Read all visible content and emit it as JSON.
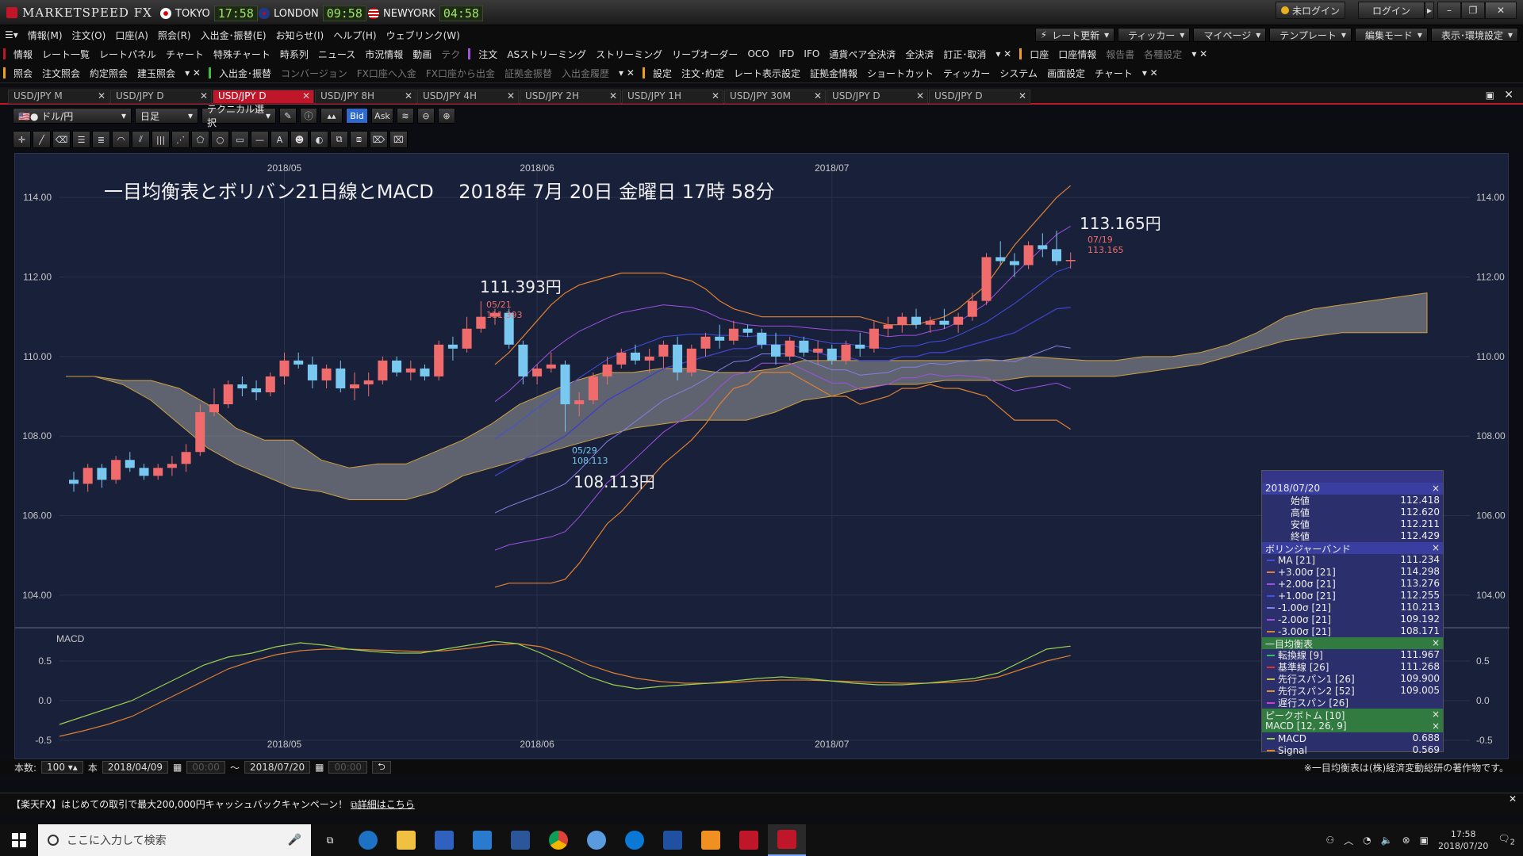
{
  "app": {
    "title": "MARKETSPEED FX",
    "tokyo_label": "TOKYO",
    "tokyo_time": "17:58",
    "london_label": "LONDON",
    "london_time": "09:58",
    "newyork_label": "NEWYORK",
    "newyork_time": "04:58",
    "login_status": "未ログイン",
    "login_button": "ログイン"
  },
  "menu_main": [
    "情報(M)",
    "注文(O)",
    "口座(A)",
    "照会(R)",
    "入出金･振替(E)",
    "お知らせ(I)",
    "ヘルプ(H)",
    "ウェブリンク(W)"
  ],
  "menu_right": [
    "レート更新",
    "ティッカー",
    "マイページ",
    "テンプレート",
    "編集モード",
    "表示･環境設定"
  ],
  "toolbar_row1": {
    "info_label": "情報",
    "info_items": [
      "レート一覧",
      "レートパネル",
      "チャート",
      "特殊チャート",
      "時系列",
      "ニュース",
      "市況情報",
      "動画",
      "テク"
    ],
    "order_label": "注文",
    "order_items": [
      "ASストリーミング",
      "ストリーミング",
      "リーブオーダー",
      "OCO",
      "IFD",
      "IFO",
      "通貨ペア全決済",
      "全決済",
      "訂正･取消"
    ],
    "account_label": "口座",
    "account_items": [
      "口座情報",
      "報告書",
      "各種設定"
    ]
  },
  "toolbar_row2": {
    "inquiry_label": "照会",
    "inquiry_items": [
      "注文照会",
      "約定照会",
      "建玉照会"
    ],
    "transfer_label": "入出金･振替",
    "transfer_items": [
      "コンバージョン",
      "FX口座へ入金",
      "FX口座から出金",
      "証拠金振替",
      "入出金履歴"
    ],
    "settings_label": "設定",
    "settings_items": [
      "注文･約定",
      "レート表示設定",
      "証拠金情報",
      "ショートカット",
      "ティッカー",
      "システム",
      "画面設定",
      "チャート"
    ]
  },
  "tabs": [
    "USD/JPY M",
    "USD/JPY D",
    "USD/JPY D",
    "USD/JPY 8H",
    "USD/JPY 4H",
    "USD/JPY 2H",
    "USD/JPY 1H",
    "USD/JPY 30M",
    "USD/JPY D",
    "USD/JPY D"
  ],
  "active_tab": 2,
  "chart_toolbar": {
    "pair": "ドル/円",
    "period": "日足",
    "technical": "テクニカル選択",
    "bid": "Bid",
    "ask": "Ask"
  },
  "chart_title": "一目均衡表とボリバン21日線とMACD　 2018年 7月 20日 金曜日 17時 58分",
  "annotations": {
    "high1_label": "111.393円",
    "high1_date": "05/21",
    "high1_val": "111.393",
    "low_label": "108.113円",
    "low_date": "05/29",
    "low_val": "108.113",
    "high2_label": "113.165円",
    "high2_date": "07/19",
    "high2_val": "113.165"
  },
  "chart_data": {
    "type": "candlestick",
    "title": "一目均衡表とボリバン21日線とMACD",
    "x_ticks": [
      "2018/05",
      "2018/06",
      "2018/07"
    ],
    "y_ticks": [
      "104.00",
      "106.00",
      "108.00",
      "110.00",
      "112.00",
      "114.00"
    ],
    "ylim": [
      103.2,
      115.1
    ],
    "macd_label": "MACD",
    "macd_ticks": [
      "0.5",
      "0.0",
      "-0.5"
    ],
    "macd_ylim": [
      -0.75,
      0.9
    ],
    "candles": [
      [
        106.9,
        107.1,
        106.6,
        106.8
      ],
      [
        106.8,
        107.3,
        106.6,
        107.2
      ],
      [
        107.2,
        107.3,
        106.7,
        106.9
      ],
      [
        106.9,
        107.5,
        106.8,
        107.4
      ],
      [
        107.4,
        107.6,
        107.1,
        107.2
      ],
      [
        107.2,
        107.3,
        106.9,
        107.0
      ],
      [
        107.0,
        107.3,
        106.9,
        107.2
      ],
      [
        107.2,
        107.5,
        107.0,
        107.3
      ],
      [
        107.3,
        107.8,
        107.1,
        107.6
      ],
      [
        107.6,
        108.8,
        107.5,
        108.6
      ],
      [
        108.6,
        109.2,
        108.5,
        108.8
      ],
      [
        108.8,
        109.4,
        108.7,
        109.3
      ],
      [
        109.3,
        109.5,
        109.0,
        109.2
      ],
      [
        109.2,
        109.4,
        108.9,
        109.1
      ],
      [
        109.1,
        109.6,
        109.0,
        109.5
      ],
      [
        109.5,
        110.1,
        109.3,
        109.9
      ],
      [
        109.9,
        110.1,
        109.7,
        109.8
      ],
      [
        109.8,
        110.0,
        109.2,
        109.4
      ],
      [
        109.4,
        109.8,
        109.2,
        109.7
      ],
      [
        109.7,
        109.9,
        109.1,
        109.2
      ],
      [
        109.2,
        109.6,
        108.9,
        109.3
      ],
      [
        109.3,
        109.6,
        109.0,
        109.4
      ],
      [
        109.4,
        110.0,
        109.3,
        109.9
      ],
      [
        109.9,
        110.0,
        109.5,
        109.6
      ],
      [
        109.6,
        109.9,
        109.4,
        109.7
      ],
      [
        109.7,
        109.8,
        109.4,
        109.5
      ],
      [
        109.5,
        110.4,
        109.4,
        110.3
      ],
      [
        110.3,
        110.5,
        109.9,
        110.2
      ],
      [
        110.2,
        111.0,
        110.1,
        110.7
      ],
      [
        110.7,
        111.393,
        110.6,
        111.0
      ],
      [
        111.0,
        111.2,
        110.8,
        111.1
      ],
      [
        111.1,
        111.2,
        110.2,
        110.3
      ],
      [
        110.3,
        110.4,
        109.3,
        109.5
      ],
      [
        109.5,
        109.8,
        109.3,
        109.7
      ],
      [
        109.7,
        110.1,
        109.6,
        109.8
      ],
      [
        109.8,
        109.9,
        108.113,
        108.8
      ],
      [
        108.8,
        109.1,
        108.5,
        108.9
      ],
      [
        108.9,
        109.6,
        108.8,
        109.5
      ],
      [
        109.5,
        110.0,
        109.3,
        109.8
      ],
      [
        109.8,
        110.2,
        109.7,
        110.1
      ],
      [
        110.1,
        110.3,
        109.8,
        109.9
      ],
      [
        109.9,
        110.2,
        109.6,
        110.0
      ],
      [
        110.0,
        110.4,
        109.7,
        110.3
      ],
      [
        110.3,
        110.5,
        109.4,
        109.6
      ],
      [
        109.6,
        110.3,
        109.5,
        110.2
      ],
      [
        110.2,
        110.6,
        110.0,
        110.5
      ],
      [
        110.5,
        110.8,
        110.2,
        110.4
      ],
      [
        110.4,
        110.9,
        110.3,
        110.7
      ],
      [
        110.7,
        110.8,
        110.5,
        110.6
      ],
      [
        110.6,
        110.7,
        110.2,
        110.3
      ],
      [
        110.3,
        110.6,
        109.8,
        110.0
      ],
      [
        110.0,
        110.5,
        109.9,
        110.4
      ],
      [
        110.4,
        110.5,
        110.0,
        110.1
      ],
      [
        110.1,
        110.4,
        109.8,
        110.2
      ],
      [
        110.2,
        110.3,
        109.8,
        109.9
      ],
      [
        109.9,
        110.4,
        109.8,
        110.3
      ],
      [
        110.3,
        110.6,
        110.0,
        110.2
      ],
      [
        110.2,
        110.9,
        110.1,
        110.7
      ],
      [
        110.7,
        111.0,
        110.5,
        110.8
      ],
      [
        110.8,
        111.1,
        110.6,
        111.0
      ],
      [
        111.0,
        111.2,
        110.7,
        110.8
      ],
      [
        110.8,
        111.0,
        110.6,
        110.9
      ],
      [
        110.9,
        111.2,
        110.7,
        110.8
      ],
      [
        110.8,
        111.1,
        110.6,
        111.0
      ],
      [
        111.0,
        111.6,
        110.9,
        111.4
      ],
      [
        111.4,
        112.6,
        111.3,
        112.5
      ],
      [
        112.5,
        112.9,
        112.3,
        112.4
      ],
      [
        112.4,
        112.6,
        112.0,
        112.3
      ],
      [
        112.3,
        112.9,
        112.2,
        112.8
      ],
      [
        112.8,
        113.1,
        112.5,
        112.7
      ],
      [
        112.7,
        113.165,
        112.3,
        112.4
      ],
      [
        112.418,
        112.62,
        112.211,
        112.429
      ]
    ],
    "bollinger": {
      "ma": [
        107.0,
        107.2,
        107.4,
        107.6,
        107.8,
        108.0,
        108.3,
        108.6,
        108.9,
        109.1,
        109.3,
        109.5,
        109.7,
        109.8,
        109.9,
        110.0,
        110.1,
        110.2,
        110.2,
        110.3,
        110.3,
        110.3,
        110.2,
        110.1,
        110.0,
        110.0,
        109.9,
        109.9,
        109.9,
        110.0,
        110.0,
        110.1,
        110.1,
        110.2,
        110.3,
        110.4,
        110.5,
        110.6,
        110.8,
        111.0,
        111.2,
        111.234
      ],
      "p3": [
        109.8,
        110.1,
        110.5,
        110.9,
        111.3,
        111.6,
        111.8,
        111.9,
        112.0,
        112.1,
        112.1,
        112.1,
        112.1,
        112.0,
        111.9,
        111.7,
        111.4,
        111.2,
        111.1,
        111.0,
        111.0,
        111.0,
        111.0,
        111.0,
        111.0,
        111.0,
        111.0,
        110.9,
        110.8,
        110.8,
        110.8,
        110.9,
        111.0,
        111.2,
        111.5,
        111.8,
        112.3,
        112.8,
        113.2,
        113.6,
        114.0,
        114.298
      ],
      "m3": [
        104.2,
        104.3,
        104.3,
        104.3,
        104.3,
        104.4,
        104.8,
        105.3,
        105.8,
        106.1,
        106.5,
        106.9,
        107.3,
        107.6,
        107.9,
        108.3,
        108.8,
        109.2,
        109.3,
        109.6,
        109.6,
        109.6,
        109.4,
        109.2,
        109.0,
        109.0,
        108.8,
        108.9,
        109.0,
        109.2,
        109.2,
        109.3,
        109.2,
        109.2,
        109.1,
        109.0,
        108.7,
        108.4,
        108.4,
        108.4,
        108.4,
        108.171
      ]
    },
    "ichimoku_cloud_top": [
      109.5,
      109.5,
      109.4,
      109.4,
      109.2,
      108.8,
      108.2,
      107.9,
      107.9,
      107.4,
      107.2,
      107.3,
      107.3,
      107.6,
      107.9,
      108.3,
      108.8,
      109.1,
      109.4,
      109.6,
      109.6,
      109.7,
      109.7,
      109.6,
      109.6,
      109.7,
      109.9,
      109.9,
      109.9,
      109.9,
      109.9,
      109.9,
      109.9,
      109.9,
      110.0,
      109.95,
      109.9,
      109.9,
      110.0,
      110.0,
      110.1,
      110.3,
      110.6,
      111.0,
      111.2,
      111.3,
      111.4,
      111.5,
      111.6
    ],
    "ichimoku_cloud_bottom": [
      109.5,
      109.5,
      109.3,
      108.9,
      108.3,
      107.7,
      107.3,
      107.0,
      106.7,
      106.6,
      106.4,
      106.4,
      106.4,
      106.6,
      107.0,
      107.2,
      107.4,
      107.6,
      107.8,
      108.0,
      108.2,
      108.3,
      108.4,
      108.4,
      108.4,
      108.6,
      108.9,
      109.0,
      109.2,
      109.3,
      109.3,
      109.4,
      109.4,
      109.4,
      109.5,
      109.5,
      109.5,
      109.5,
      109.6,
      109.7,
      109.8,
      110.0,
      110.2,
      110.4,
      110.5,
      110.6,
      110.6,
      110.6,
      110.6
    ],
    "macd": [
      -0.3,
      -0.2,
      -0.1,
      0.0,
      0.15,
      0.3,
      0.45,
      0.55,
      0.6,
      0.68,
      0.73,
      0.7,
      0.65,
      0.62,
      0.6,
      0.6,
      0.65,
      0.7,
      0.75,
      0.72,
      0.6,
      0.45,
      0.3,
      0.2,
      0.15,
      0.18,
      0.2,
      0.22,
      0.25,
      0.28,
      0.3,
      0.28,
      0.25,
      0.22,
      0.2,
      0.2,
      0.22,
      0.25,
      0.28,
      0.35,
      0.5,
      0.65,
      0.688
    ],
    "signal": [
      -0.45,
      -0.38,
      -0.3,
      -0.2,
      -0.05,
      0.1,
      0.25,
      0.4,
      0.5,
      0.58,
      0.63,
      0.65,
      0.65,
      0.64,
      0.63,
      0.62,
      0.63,
      0.66,
      0.7,
      0.72,
      0.68,
      0.58,
      0.45,
      0.35,
      0.28,
      0.24,
      0.22,
      0.22,
      0.23,
      0.25,
      0.26,
      0.26,
      0.25,
      0.24,
      0.23,
      0.22,
      0.22,
      0.23,
      0.25,
      0.3,
      0.4,
      0.5,
      0.569
    ],
    "colors": {
      "up": "#f06c6c",
      "down": "#78c8f0",
      "cloud": "#9a9a9a",
      "ma": "#4040c0",
      "p3": "#e08030",
      "m3": "#e08030",
      "macd": "#9ad050",
      "signal": "#e08030"
    }
  },
  "data_window": {
    "date": "2018/07/20",
    "ohlc": [
      {
        "name": "始値",
        "value": "112.418"
      },
      {
        "name": "高値",
        "value": "112.620"
      },
      {
        "name": "安値",
        "value": "112.211"
      },
      {
        "name": "終値",
        "value": "112.429"
      }
    ],
    "bb_title": "ボリンジャーバンド",
    "bb": [
      {
        "name": "MA [21]",
        "value": "111.234",
        "color": "#4a4ad8"
      },
      {
        "name": "+3.00σ [21]",
        "value": "114.298",
        "color": "#e08030"
      },
      {
        "name": "+2.00σ [21]",
        "value": "113.276",
        "color": "#a050e0"
      },
      {
        "name": "+1.00σ [21]",
        "value": "112.255",
        "color": "#4050e0"
      },
      {
        "name": "-1.00σ [21]",
        "value": "110.213",
        "color": "#8080e0"
      },
      {
        "name": "-2.00σ [21]",
        "value": "109.192",
        "color": "#a050e0"
      },
      {
        "name": "-3.00σ [21]",
        "value": "108.171",
        "color": "#e08030"
      }
    ],
    "ichi_title": "一目均衡表",
    "ichi": [
      {
        "name": "転換線 [9]",
        "value": "111.967",
        "color": "#30c060"
      },
      {
        "name": "基準線 [26]",
        "value": "111.268",
        "color": "#e03030"
      },
      {
        "name": "先行スパン1 [26]",
        "value": "109.900",
        "color": "#d0c040"
      },
      {
        "name": "先行スパン2 [52]",
        "value": "109.005",
        "color": "#e09030"
      },
      {
        "name": "遅行スパン [26]",
        "value": "",
        "color": "#d040d0"
      }
    ],
    "peak_title": "ピークボトム [10]",
    "macd_title": "MACD [12, 26, 9]",
    "macd": [
      {
        "name": "MACD",
        "value": "0.688",
        "color": "#9ad050"
      },
      {
        "name": "Signal",
        "value": "0.569",
        "color": "#e08030"
      }
    ]
  },
  "footer": {
    "count_label": "本数:",
    "count_value": "100",
    "count_unit": "本",
    "from_date": "2018/04/09",
    "from_time": "00:00",
    "to_date": "2018/07/20",
    "to_time": "00:00",
    "note": "※一目均衡表は(株)経済変動総研の著作物です。"
  },
  "banner": {
    "text": "【楽天FX】はじめての取引で最大200,000円キャッシュバックキャンペーン！",
    "link": "詳細はこちら"
  },
  "taskbar": {
    "search_placeholder": "ここに入力して検索",
    "time": "17:58",
    "date": "2018/07/20",
    "notif_count": "2"
  }
}
